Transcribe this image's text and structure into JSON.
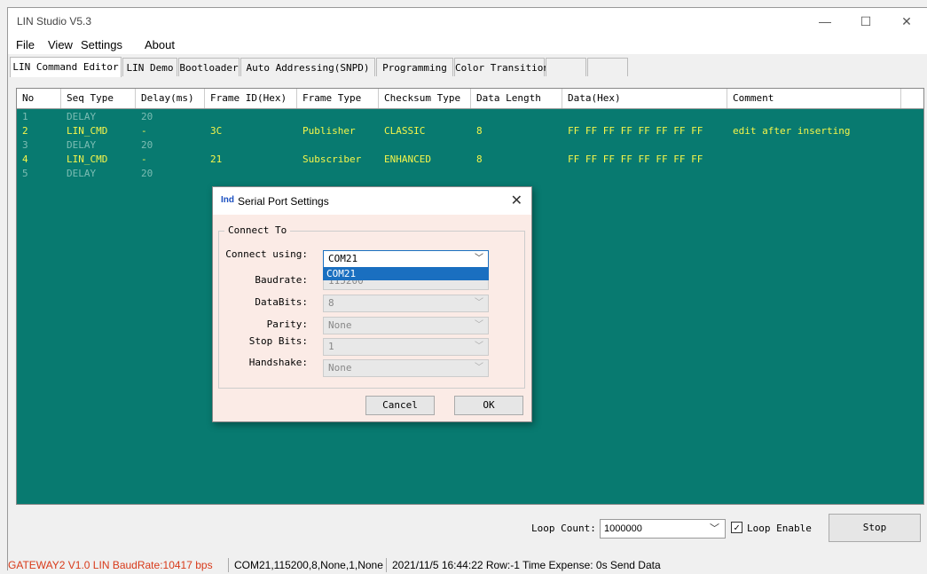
{
  "window": {
    "title": "LIN Studio V5.3",
    "minimize": "—",
    "maximize": "☐",
    "close": "✕"
  },
  "menu": [
    "File",
    "View",
    "Settings",
    "About"
  ],
  "tabs": [
    "LIN Command Editor",
    "LIN Demo",
    "Bootloader",
    "Auto Addressing(SNPD)",
    "Programming",
    "Color Transition"
  ],
  "grid": {
    "headers": [
      "No",
      "Seq Type",
      "Delay(ms)",
      "Frame ID(Hex)",
      "Frame Type",
      "Checksum Type",
      "Data Length",
      "Data(Hex)",
      "Comment"
    ],
    "rows": [
      {
        "no": "1",
        "seq": "DELAY",
        "delay": "20",
        "id": "",
        "ftype": "",
        "cks": "",
        "len": "",
        "data": "",
        "comment": "",
        "style": "dim"
      },
      {
        "no": "2",
        "seq": "LIN_CMD",
        "delay": "-",
        "id": "3C",
        "ftype": "Publisher",
        "cks": "CLASSIC",
        "len": "8",
        "data": "FF FF FF FF FF FF FF FF",
        "comment": "edit after inserting",
        "style": "hi"
      },
      {
        "no": "3",
        "seq": "DELAY",
        "delay": "20",
        "id": "",
        "ftype": "",
        "cks": "",
        "len": "",
        "data": "",
        "comment": "",
        "style": "dim"
      },
      {
        "no": "4",
        "seq": "LIN_CMD",
        "delay": "-",
        "id": "21",
        "ftype": "Subscriber",
        "cks": "ENHANCED",
        "len": "8",
        "data": "FF FF FF FF FF FF FF FF",
        "comment": "",
        "style": "hi"
      },
      {
        "no": "5",
        "seq": "DELAY",
        "delay": "20",
        "id": "",
        "ftype": "",
        "cks": "",
        "len": "",
        "data": "",
        "comment": "",
        "style": "dim"
      }
    ]
  },
  "bottom": {
    "loop_count_label": "Loop Count:",
    "loop_count_value": "1000000",
    "loop_enable_label": "Loop Enable",
    "loop_enable_checked": true,
    "stop_label": "Stop"
  },
  "status": {
    "gateway": "GATEWAY2  V1.0   LIN BaudRate:10417 bps",
    "port": "COM21,115200,8,None,1,None",
    "info": "2021/11/5 16:44:22  Row:-1  Time Expense: 0s  Send Data",
    "gateway_color": "#d83a1a"
  },
  "dialog": {
    "icon_text": "Ind",
    "title": "Serial Port Settings",
    "group_label": "Connect To",
    "connect_using_label": "Connect using:",
    "connect_using_value": "COM21",
    "dropdown_option": "COM21",
    "baudrate_label": "Baudrate:",
    "baudrate_value": "115200",
    "databits_label": "DataBits:",
    "databits_value": "8",
    "parity_label": "Parity:",
    "parity_value": "None",
    "stopbits_label": "Stop Bits:",
    "stopbits_value": "1",
    "handshake_label": "Handshake:",
    "handshake_value": "None",
    "cancel_label": "Cancel",
    "ok_label": "OK",
    "close": "✕"
  },
  "colors": {
    "grid_bg": "#087a70",
    "highlight_text": "#f5f54a",
    "accent_blue": "#1a6fc0"
  }
}
